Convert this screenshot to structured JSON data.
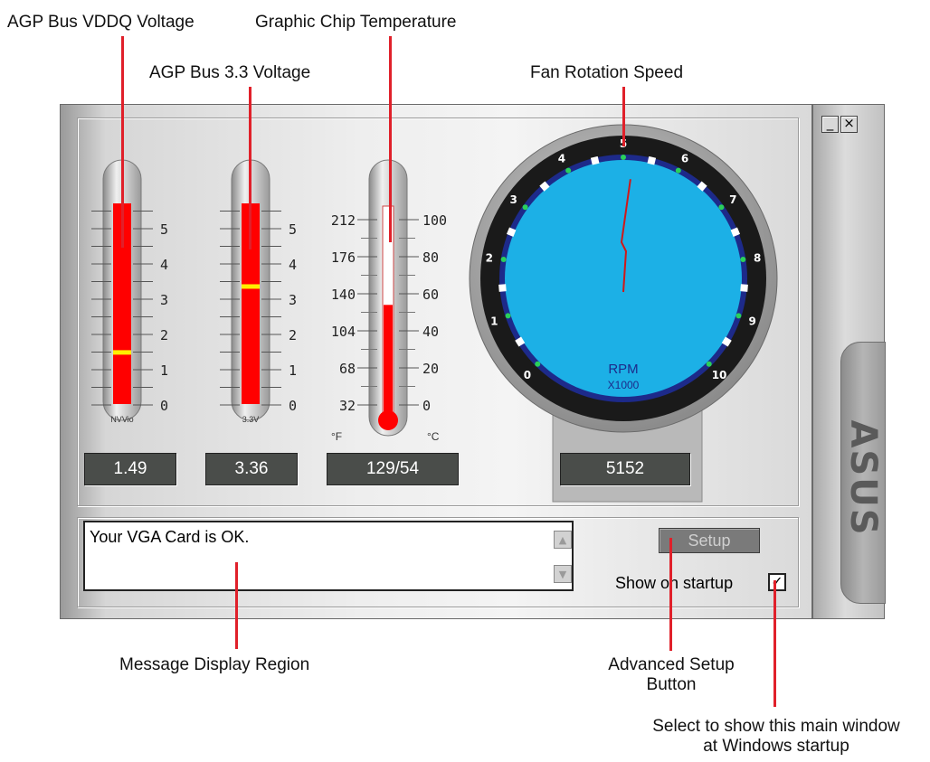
{
  "callouts": {
    "vddq": "AGP Bus VDDQ Voltage",
    "chip_temp": "Graphic Chip Temperature",
    "bus33": "AGP Bus 3.3 Voltage",
    "fan": "Fan Rotation Speed",
    "message_region": "Message Display Region",
    "setup_line1": "Advanced Setup",
    "setup_line2": "Button",
    "startup_line1": "Select to show this main window",
    "startup_line2": "at Windows startup"
  },
  "gauges": {
    "vddq": {
      "label": "NVVio",
      "scale": [
        "5",
        "4",
        "3",
        "2",
        "1",
        "0"
      ],
      "value": 1.49,
      "max": 6,
      "readout": "1.49"
    },
    "bus33": {
      "label": "3.3V",
      "scale": [
        "5",
        "4",
        "3",
        "2",
        "1",
        "0"
      ],
      "value": 3.36,
      "max": 6,
      "readout": "3.36"
    },
    "temp": {
      "f_scale": [
        "212",
        "176",
        "140",
        "104",
        "68",
        "32"
      ],
      "c_scale": [
        "100",
        "80",
        "60",
        "40",
        "20",
        "0"
      ],
      "f_unit": "°F",
      "c_unit": "°C",
      "value_c": 54,
      "readout": "129/54"
    },
    "fan": {
      "dial_numbers": [
        "0",
        "1",
        "2",
        "3",
        "4",
        "5",
        "6",
        "7",
        "8",
        "9",
        "10"
      ],
      "unit_line1": "RPM",
      "unit_line2": "X1000",
      "value_rpm": 5152,
      "readout": "5152"
    }
  },
  "message": {
    "text": "Your VGA Card is OK."
  },
  "setup": {
    "label": "Setup"
  },
  "startup": {
    "label": "Show on startup",
    "checked": true,
    "check_glyph": "✓"
  },
  "window_controls": {
    "minimize": "_",
    "close": "×"
  },
  "brand": {
    "logo": "ASUS"
  },
  "colors": {
    "callout_line": "#e0202a",
    "gauge_fill": "#ff0000",
    "gauge_marker": "#ffee00",
    "dial_face": "#1cb0e6",
    "dial_ring": "#1d2a8a"
  }
}
